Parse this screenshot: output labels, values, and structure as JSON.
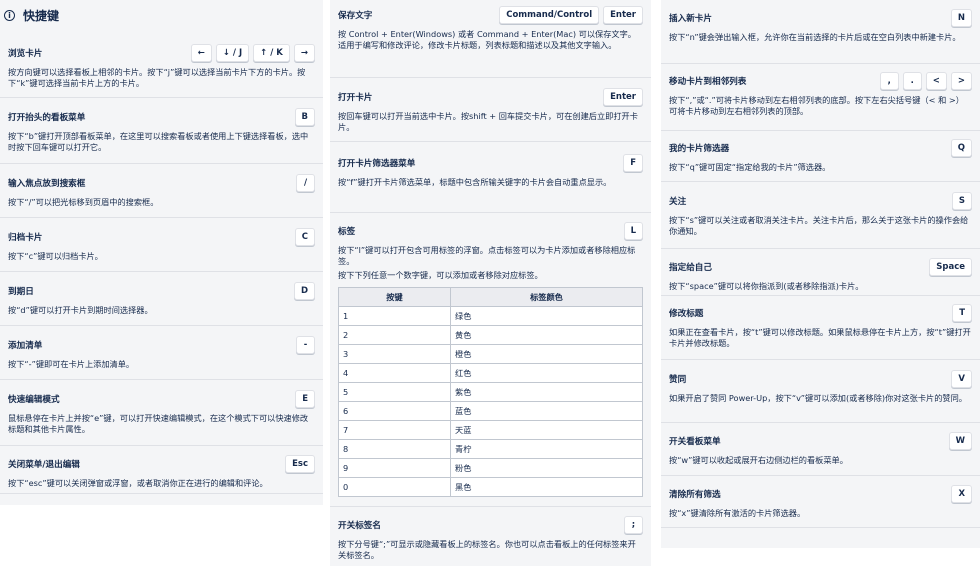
{
  "header": {
    "title": "快捷键"
  },
  "col1": [
    {
      "title": "浏览卡片",
      "keys": [
        "←",
        "↓ / J",
        "↑ / K",
        "→"
      ],
      "desc": "按方向键可以选择看板上相邻的卡片。按下“j”键可以选择当前卡片下方的卡片。按下“k”键可选择当前卡片上方的卡片。"
    },
    {
      "title": "打开抬头的看板菜单",
      "keys": [
        "B"
      ],
      "desc": "按下“b”键打开顶部看板菜单，在这里可以搜索看板或者使用上下键选择看板，选中时按下回车键可以打开它。"
    },
    {
      "title": "输入焦点放到搜索框",
      "keys": [
        "/"
      ],
      "desc": "按下“/”可以把光标移到页眉中的搜索框。"
    },
    {
      "title": "归档卡片",
      "keys": [
        "C"
      ],
      "desc": "按下“c”键可以归档卡片。"
    },
    {
      "title": "到期日",
      "keys": [
        "D"
      ],
      "desc": "按“d”键可以打开卡片到期时间选择器。"
    },
    {
      "title": "添加清单",
      "keys": [
        "-"
      ],
      "desc": "按下“-”键即可在卡片上添加清单。"
    },
    {
      "title": "快速编辑模式",
      "keys": [
        "E"
      ],
      "desc": "鼠标悬停在卡片上并按“e”键，可以打开快速编辑模式，在这个模式下可以快速修改标题和其他卡片属性。"
    },
    {
      "title": "关闭菜单/退出编辑",
      "keys": [
        "Esc"
      ],
      "desc": "按下“esc”键可以关闭弹窗或浮窗，或者取消你正在进行的编辑和评论。"
    }
  ],
  "col2": {
    "save": {
      "title": "保存文字",
      "keys": [
        "Command/Control",
        "Enter"
      ],
      "desc": "按 Control + Enter(Windows) 或者 Command + Enter(Mac) 可以保存文字。适用于编写和修改评论，修改卡片标题，列表标题和描述以及其他文字输入。"
    },
    "open": {
      "title": "打开卡片",
      "keys": [
        "Enter"
      ],
      "desc": "按回车键可以打开当前选中卡片。按shift + 回车提交卡片，可在创建后立即打开卡片。"
    },
    "filter": {
      "title": "打开卡片筛选器菜单",
      "keys": [
        "F"
      ],
      "desc": "按“f”键打开卡片筛选菜单，标题中包含所输关键字的卡片会自动重点显示。"
    },
    "labels": {
      "title": "标签",
      "keys": [
        "L"
      ],
      "desc": "按下“l”键可以打开包含可用标签的浮窗。点击标签可以为卡片添加或者移除相应标签。",
      "desc2": "按下下列任意一个数字键，可以添加或者移除对应标签。",
      "table": {
        "headers": [
          "按键",
          "标签颜色"
        ],
        "rows": [
          [
            "1",
            "绿色"
          ],
          [
            "2",
            "黄色"
          ],
          [
            "3",
            "橙色"
          ],
          [
            "4",
            "红色"
          ],
          [
            "5",
            "紫色"
          ],
          [
            "6",
            "蓝色"
          ],
          [
            "7",
            "天蓝"
          ],
          [
            "8",
            "青柠"
          ],
          [
            "9",
            "粉色"
          ],
          [
            "0",
            "黑色"
          ]
        ]
      }
    },
    "labelnames": {
      "title": "开关标签名",
      "keys": [
        ";"
      ],
      "desc": "按下分号键“;”可显示或隐藏看板上的标签名。你也可以点击看板上的任何标签来开关标签名。"
    }
  },
  "col3": [
    {
      "title": "插入新卡片",
      "keys": [
        "N"
      ],
      "desc": "按下“n”键会弹出输入框，允许你在当前选择的卡片后或在空白列表中新建卡片。"
    },
    {
      "title": "移动卡片到相邻列表",
      "keys": [
        ",",
        ".",
        "<",
        ">"
      ],
      "desc": "按下“,”或“.”可将卡片移动到左右相邻列表的底部。按下左右尖括号键（< 和 >）可将卡片移动到左右相邻列表的顶部。"
    },
    {
      "title": "我的卡片筛选器",
      "keys": [
        "Q"
      ],
      "desc": "按下“q”键可固定“指定给我的卡片”筛选器。"
    },
    {
      "title": "关注",
      "keys": [
        "S"
      ],
      "desc": "按下“s”键可以关注或者取消关注卡片。关注卡片后，那么关于这张卡片的操作会给你通知。"
    },
    {
      "title": "指定给自己",
      "keys": [
        "Space"
      ],
      "desc": "按下“space”键可以将你指派到(或者移除指派)卡片。"
    },
    {
      "title": "修改标题",
      "keys": [
        "T"
      ],
      "desc": "如果正在查看卡片，按“t”键可以修改标题。如果鼠标悬停在卡片上方，按“t”键打开卡片并修改标题。"
    },
    {
      "title": "赞同",
      "keys": [
        "V"
      ],
      "desc": "如果开启了赞同 Power-Up，按下“v”键可以添加(或者移除)你对这张卡片的赞同。"
    },
    {
      "title": "开关看板菜单",
      "keys": [
        "W"
      ],
      "desc": "按“w”键可以收起或展开右边侧边栏的看板菜单。"
    },
    {
      "title": "清除所有筛选",
      "keys": [
        "X"
      ],
      "desc": "按“x”键清除所有激活的卡片筛选器。"
    }
  ]
}
